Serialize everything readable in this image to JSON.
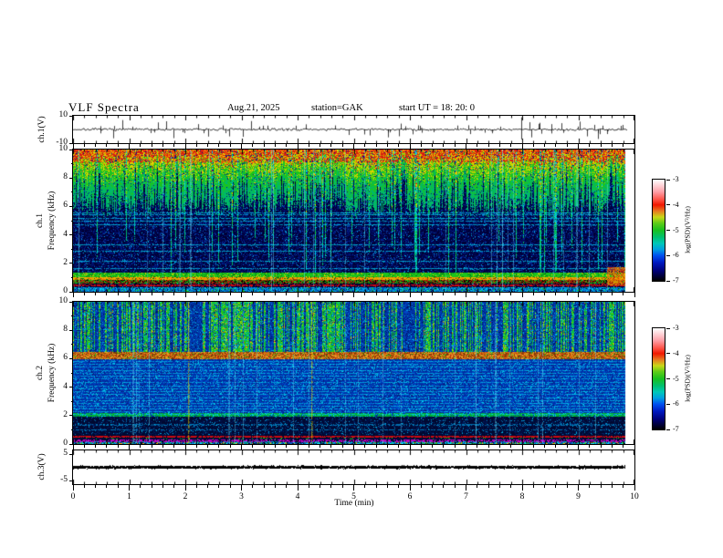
{
  "header": {
    "title": "VLF Spectra",
    "date": "Aug.21, 2025",
    "station": "station=GAK",
    "start_ut": "start UT =  18: 20: 0"
  },
  "xaxis": {
    "label": "Time (min)",
    "ticks": [
      "0",
      "1",
      "2",
      "3",
      "4",
      "5",
      "6",
      "7",
      "8",
      "9",
      "10"
    ],
    "minor_step_min": 0.2,
    "range_min": [
      0,
      10
    ]
  },
  "panels": {
    "ch1_wave": {
      "ylabel": "ch.1(V)",
      "yticks": [
        "10",
        "-10"
      ],
      "ylim": [
        -10,
        10
      ]
    },
    "ch1_spec": {
      "ylabel_ch": "ch.1",
      "ylabel_axis": "Frequency (kHz)",
      "yticks": [
        "0",
        "2",
        "4",
        "6",
        "8",
        "10"
      ],
      "yticks_minor": [
        1,
        3,
        5,
        7,
        9
      ],
      "ylim_khz": [
        0,
        10
      ]
    },
    "ch2_spec": {
      "ylabel_ch": "ch.2",
      "ylabel_axis": "Frequency (kHz)",
      "yticks": [
        "0",
        "2",
        "4",
        "6",
        "8",
        "10"
      ],
      "yticks_minor": [
        1,
        3,
        5,
        7,
        9
      ],
      "ylim_khz": [
        0,
        10
      ]
    },
    "ch3_wave": {
      "ylabel": "ch.3(V)",
      "yticks": [
        "5",
        "-5"
      ],
      "ylim": [
        -5,
        5
      ]
    }
  },
  "colorbar": {
    "label": "log(PSD)(V²/Hz)",
    "ticks": [
      "-3",
      "-4",
      "-5",
      "-6",
      "-7"
    ],
    "zlim": [
      -7,
      -3
    ],
    "gradient_stops": [
      [
        "#ffffff",
        0
      ],
      [
        "#ffd8dc",
        5
      ],
      [
        "#ffa0a8",
        12
      ],
      [
        "#ff5044",
        20
      ],
      [
        "#f01800",
        25
      ],
      [
        "#e87820",
        31
      ],
      [
        "#c8d818",
        37
      ],
      [
        "#5ecc18",
        43
      ],
      [
        "#18c020",
        50
      ],
      [
        "#00c070",
        57
      ],
      [
        "#00c8b8",
        63
      ],
      [
        "#00a0e0",
        69
      ],
      [
        "#0050f0",
        75
      ],
      [
        "#0018c0",
        82
      ],
      [
        "#000078",
        90
      ],
      [
        "#000000",
        100
      ]
    ]
  },
  "chart_data": [
    {
      "type": "line",
      "name": "ch1_waveform",
      "ylabel": "ch.1(V)",
      "xlim_min": [
        0,
        10
      ],
      "ylim_v": [
        -10,
        10
      ],
      "yticks": [
        10,
        -10
      ],
      "description": "broadband VLF waveform: continuous ~±2 V noise with sparse impulsive sferic spikes reaching toward ±10 V",
      "noise_v": 1.3,
      "spike_count": 70,
      "spike_max_v": 10,
      "seed": 7,
      "data_end_frac": 0.99
    },
    {
      "type": "heatmap",
      "name": "ch1_spectrogram",
      "xlim_min": [
        0,
        10
      ],
      "ylim_khz": [
        0,
        10
      ],
      "zlim_log_psd": [
        -7,
        -3
      ],
      "description": "spectrogram ch.1: intense sferic activity above ~6 kHz (green/yellow/red), dark-blue quiet region 1.5–6 kHz crossed by narrow cyan tone lines and vertical streaks, bright layered hiss bands below 1.3 kHz, orange patch near 9.7 min at ~1 kHz",
      "seed": 11,
      "data_end_frac": 0.985,
      "deep_streak_prob": 0.07,
      "tone_lines_khz": [
        5.6,
        5.45,
        5.2,
        5.0,
        4.75,
        3.35,
        2.9,
        2.2,
        1.65
      ],
      "bottom_bands_khz": [
        {
          "f": [
            1.02,
            1.32
          ],
          "look": "green band"
        },
        {
          "f": [
            0.84,
            1.02
          ],
          "look": "yellow-orange line"
        },
        {
          "f": [
            0.56,
            0.84
          ],
          "look": "dark red/green mottle"
        },
        {
          "f": [
            0.34,
            0.56
          ],
          "look": "dark blue with red line at 0.45"
        },
        {
          "f": [
            0.0,
            0.34
          ],
          "look": "cyan-blue speckle"
        }
      ],
      "hot_patch": {
        "t_frac": [
          0.952,
          0.984
        ],
        "f_khz": [
          0.5,
          1.7
        ]
      }
    },
    {
      "type": "heatmap",
      "name": "ch2_spectrogram",
      "xlim_min": [
        0,
        10
      ],
      "ylim_khz": [
        0,
        10
      ],
      "zlim_log_psd": [
        -7,
        -3
      ],
      "description": "spectrogram ch.2: blue background with dense vertical sferic streaks above 6.4 kHz, strong orange hiss band at ~6.2 kHz, many narrow cyan tone lines 2–6 kHz, green band ~2 kHz, dark band 0.6–1.9 kHz, red line ~0.5 kHz, magenta lines ~0.25 kHz",
      "seed": 23,
      "data_end_frac": 0.985,
      "streak_prob": 0.5,
      "hiss_band_khz": [
        5.95,
        6.45
      ],
      "tone_lines_khz": [
        2.1,
        2.3,
        2.5,
        2.7,
        2.9,
        3.1,
        3.3,
        3.5,
        3.7,
        3.9,
        4.1,
        4.35,
        4.6,
        4.8,
        5.0,
        5.2,
        5.45,
        5.65,
        5.85
      ],
      "tone_lines_upper_khz": [
        7.0,
        7.4,
        8.1
      ],
      "green_band_khz": [
        1.9,
        2.15
      ],
      "dark_band_khz": [
        0.62,
        1.9
      ],
      "red_line_khz": 0.5,
      "magenta_lines_khz": [
        0.26,
        0.18
      ]
    },
    {
      "type": "line",
      "name": "ch3_waveform",
      "ylabel": "ch.3(V)",
      "xlim_min": [
        0,
        10
      ],
      "ylim_v": [
        -5,
        5
      ],
      "yticks": [
        5,
        -5
      ],
      "description": "inactive channel: flat thick trace at 0 V",
      "value_v": 0,
      "seed": 3,
      "data_end_frac": 0.985
    }
  ]
}
